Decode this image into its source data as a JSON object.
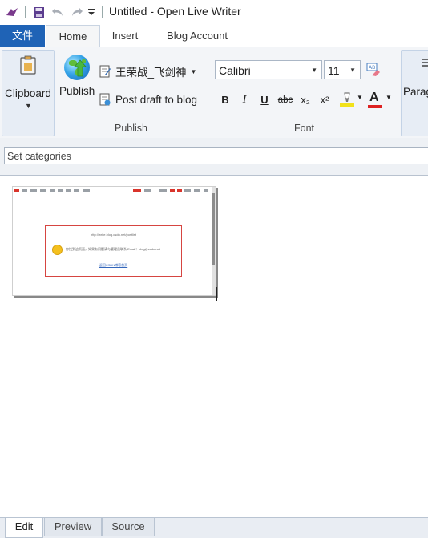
{
  "window": {
    "title": "Untitled - Open Live Writer"
  },
  "quick_access": {
    "icons": [
      "app-icon",
      "save-icon",
      "undo-icon",
      "redo-icon",
      "customize-dropdown-icon"
    ]
  },
  "ribbon_tabs": {
    "file": "文件",
    "home": "Home",
    "insert": "Insert",
    "blog_account": "Blog Account"
  },
  "clipboard": {
    "label": "Clipboard"
  },
  "publish_group": {
    "label": "Publish",
    "publish_button": "Publish",
    "account_name": "王荣战_飞剑神",
    "post_draft": "Post draft to blog"
  },
  "font_group": {
    "label": "Font",
    "font_name": "Calibri",
    "font_size": "11",
    "bold": "B",
    "italic": "I",
    "underline": "U",
    "strike": "abc",
    "subscript": "x₂",
    "superscript": "x²",
    "font_color_letter": "A"
  },
  "paragraph_group": {
    "label": "Parag"
  },
  "categories": {
    "placeholder": "Set categories"
  },
  "embedded_image": {
    "url_text": "http://write.blog.csdn.net/postlist",
    "message": "你找到这页面，如果有问题请与管理员联系 Email：blog@csdn.net",
    "link": "返回CSDN博客首页"
  },
  "bottom_tabs": {
    "edit": "Edit",
    "preview": "Preview",
    "source": "Source"
  },
  "colors": {
    "file_tab": "#1f63b6",
    "highlight": "#f2e21a",
    "font_color": "#d22",
    "red_box": "#d64541"
  }
}
